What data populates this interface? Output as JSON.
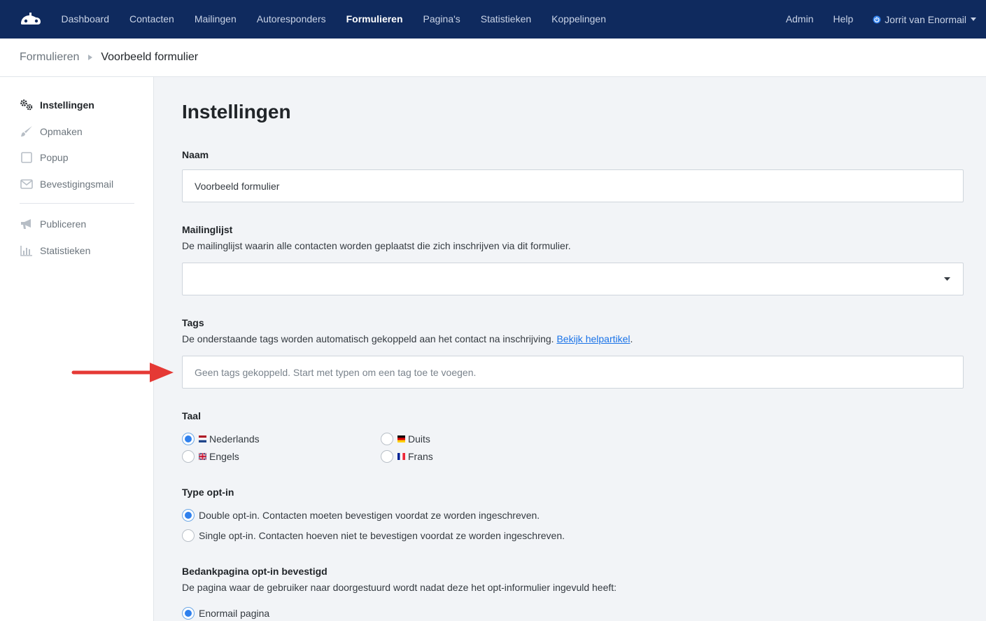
{
  "nav": {
    "items": [
      {
        "label": "Dashboard",
        "active": false
      },
      {
        "label": "Contacten",
        "active": false
      },
      {
        "label": "Mailingen",
        "active": false
      },
      {
        "label": "Autoresponders",
        "active": false
      },
      {
        "label": "Formulieren",
        "active": true
      },
      {
        "label": "Pagina's",
        "active": false
      },
      {
        "label": "Statistieken",
        "active": false
      },
      {
        "label": "Koppelingen",
        "active": false
      }
    ],
    "admin": "Admin",
    "help": "Help",
    "user": "Jorrit van Enormail"
  },
  "breadcrumb": {
    "parent": "Formulieren",
    "current": "Voorbeeld formulier"
  },
  "sidebar": {
    "items": [
      {
        "label": "Instellingen",
        "icon": "gears-icon",
        "active": true
      },
      {
        "label": "Opmaken",
        "icon": "brush-icon",
        "active": false
      },
      {
        "label": "Popup",
        "icon": "square-icon",
        "active": false
      },
      {
        "label": "Bevestigingsmail",
        "icon": "envelope-icon",
        "active": false
      },
      {
        "label": "Publiceren",
        "icon": "megaphone-icon",
        "active": false
      },
      {
        "label": "Statistieken",
        "icon": "bar-chart-icon",
        "active": false
      }
    ]
  },
  "main": {
    "title": "Instellingen",
    "naam": {
      "label": "Naam",
      "value": "Voorbeeld formulier"
    },
    "mailinglijst": {
      "label": "Mailinglijst",
      "help": "De mailinglijst waarin alle contacten worden geplaatst die zich inschrijven via dit formulier.",
      "value": ""
    },
    "tags": {
      "label": "Tags",
      "help": "De onderstaande tags worden automatisch gekoppeld aan het contact na inschrijving.",
      "help_link": "Bekijk helpartikel",
      "help_suffix": ".",
      "placeholder": "Geen tags gekoppeld. Start met typen om een tag toe te voegen."
    },
    "taal": {
      "label": "Taal",
      "options": [
        {
          "label": "Nederlands",
          "flag": "nl",
          "checked": true
        },
        {
          "label": "Engels",
          "flag": "gb",
          "checked": false
        },
        {
          "label": "Duits",
          "flag": "de",
          "checked": false
        },
        {
          "label": "Frans",
          "flag": "fr",
          "checked": false
        }
      ]
    },
    "optin": {
      "label": "Type opt-in",
      "options": [
        {
          "label": "Double opt-in. Contacten moeten bevestigen voordat ze worden ingeschreven.",
          "checked": true
        },
        {
          "label": "Single opt-in. Contacten hoeven niet te bevestigen voordat ze worden ingeschreven.",
          "checked": false
        }
      ]
    },
    "bedankpagina": {
      "label": "Bedankpagina opt-in bevestigd",
      "help": "De pagina waar de gebruiker naar doorgestuurd wordt nadat deze het opt-informulier ingevuld heeft:",
      "options": [
        {
          "label": "Enormail pagina",
          "checked": true
        }
      ]
    }
  },
  "colors": {
    "nav_bg": "#0f2a5e",
    "accent": "#2f80ed",
    "arrow": "#e53935"
  }
}
